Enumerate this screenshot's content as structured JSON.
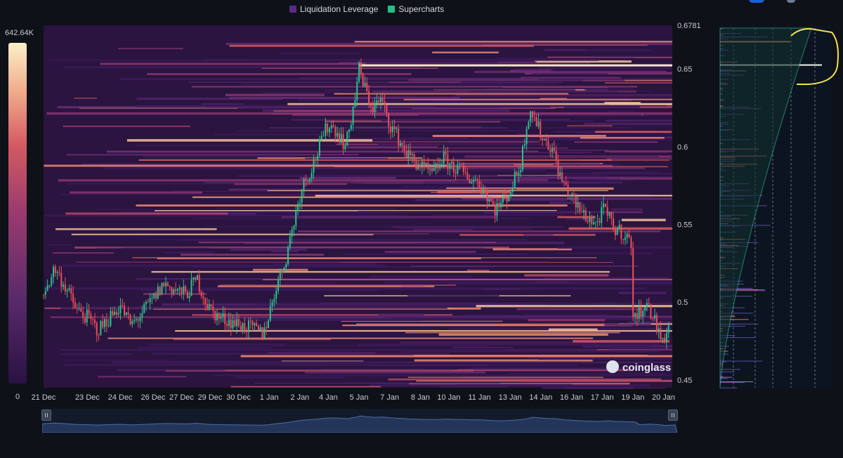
{
  "legend": {
    "items": [
      {
        "label": "Liquidation Leverage",
        "color": "#5b2a86"
      },
      {
        "label": "Supercharts",
        "color": "#22c08a"
      }
    ]
  },
  "colorbar": {
    "max_label": "642.64K",
    "min_label": "0",
    "stops": [
      "#2a1244",
      "#5a2a6a",
      "#9a3a6e",
      "#d45a62",
      "#f0a888",
      "#fbf0c8"
    ]
  },
  "watermark": {
    "label": "coinglass"
  },
  "chart_data": {
    "type": "heatmap",
    "title": "",
    "xlabel": "",
    "ylabel": "",
    "x_ticks": [
      "21 Dec",
      "23 Dec",
      "24 Dec",
      "26 Dec",
      "27 Dec",
      "29 Dec",
      "30 Dec",
      "1 Jan",
      "2 Jan",
      "4 Jan",
      "5 Jan",
      "7 Jan",
      "8 Jan",
      "10 Jan",
      "11 Jan",
      "13 Jan",
      "14 Jan",
      "16 Jan",
      "17 Jan",
      "19 Jan",
      "20 Jan"
    ],
    "x_tick_index": [
      0,
      2,
      3.5,
      5,
      6.3,
      7.6,
      8.9,
      10.3,
      11.7,
      13,
      14.4,
      15.8,
      17.2,
      18.5,
      19.9,
      21.3,
      22.7,
      24.1,
      25.5,
      26.9,
      28.3
    ],
    "y_ticks": [
      {
        "label": "0.6781",
        "value": 0.6781
      },
      {
        "label": "0.65",
        "value": 0.65
      },
      {
        "label": "0.6",
        "value": 0.6
      },
      {
        "label": "0.55",
        "value": 0.55
      },
      {
        "label": "0.5",
        "value": 0.5
      },
      {
        "label": "0.45",
        "value": 0.45
      }
    ],
    "ylim": [
      0.445,
      0.6781
    ],
    "xlim": [
      0,
      28.7
    ],
    "price_series": {
      "name": "Supercharts",
      "x": [
        0,
        0.5,
        1,
        1.5,
        2,
        2.5,
        3,
        3.5,
        4,
        4.5,
        5,
        5.5,
        6,
        6.5,
        7,
        7.5,
        8,
        8.5,
        9,
        9.5,
        10,
        10.3,
        10.6,
        11,
        11.4,
        11.8,
        12.2,
        12.6,
        13,
        13.4,
        13.8,
        14.2,
        14.4,
        14.6,
        15,
        15.4,
        15.8,
        16.2,
        16.6,
        17,
        17.4,
        17.8,
        18.2,
        18.6,
        19,
        19.4,
        19.8,
        20.2,
        20.6,
        21,
        21.4,
        21.8,
        22,
        22.2,
        22.5,
        22.8,
        23.2,
        23.6,
        24,
        24.4,
        24.8,
        25.2,
        25.6,
        26,
        26.4,
        26.8,
        26.9,
        27.1,
        27.4,
        27.8,
        28.2,
        28.6
      ],
      "y": [
        0.505,
        0.522,
        0.51,
        0.495,
        0.49,
        0.482,
        0.49,
        0.498,
        0.485,
        0.493,
        0.502,
        0.512,
        0.508,
        0.505,
        0.515,
        0.497,
        0.49,
        0.488,
        0.485,
        0.483,
        0.48,
        0.492,
        0.51,
        0.525,
        0.55,
        0.575,
        0.585,
        0.6,
        0.615,
        0.61,
        0.6,
        0.63,
        0.65,
        0.64,
        0.625,
        0.63,
        0.615,
        0.605,
        0.595,
        0.59,
        0.585,
        0.582,
        0.593,
        0.588,
        0.585,
        0.58,
        0.578,
        0.57,
        0.56,
        0.565,
        0.575,
        0.59,
        0.61,
        0.625,
        0.615,
        0.605,
        0.6,
        0.58,
        0.57,
        0.56,
        0.555,
        0.55,
        0.56,
        0.548,
        0.545,
        0.54,
        0.495,
        0.49,
        0.5,
        0.492,
        0.475,
        0.485
      ]
    },
    "profile_highlight_levels": [
      0.668,
      0.653
    ]
  }
}
